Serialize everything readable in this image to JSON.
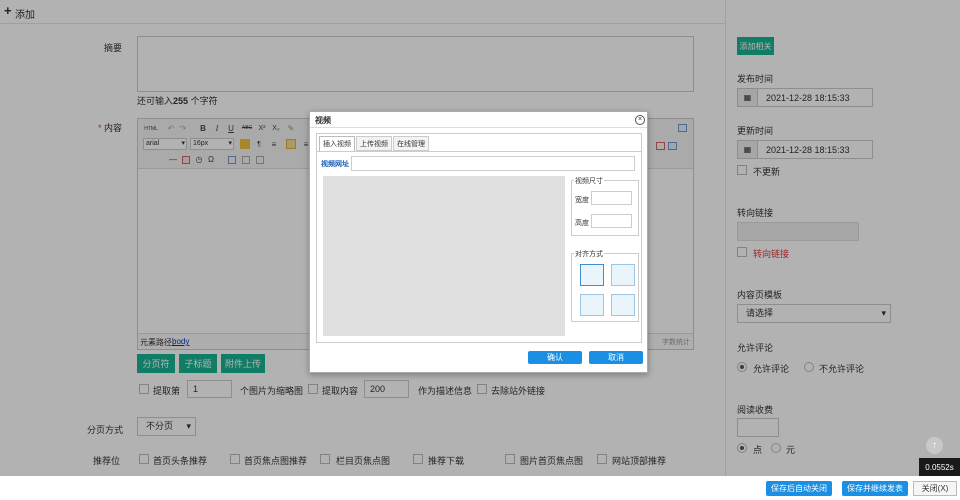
{
  "topbar": {
    "title": "添加",
    "close": "×"
  },
  "form": {
    "summary_label": "摘要",
    "summary_hint_prefix": "还可输入",
    "summary_hint_count": "255",
    "summary_hint_suffix": "个字符",
    "content_label": "内容",
    "required_mark": "*",
    "toolbar": {
      "html_btn": "HTML",
      "bold": "B",
      "italic": "I",
      "underline": "U",
      "strike": "ABC",
      "superscript": "X²",
      "subscript": "X₂",
      "font_family": "arial",
      "font_size": "16px",
      "omega": "Ω"
    },
    "element_path_label": "元素路径:",
    "element_path_value": "body",
    "word_count": "字数统计",
    "buttons": {
      "paging": "分页符",
      "subtitle": "子标题",
      "attachment": "附件上传"
    },
    "options": {
      "extract_label": "提取第",
      "extract_value": "1",
      "thumb_label": "个图片为缩略图",
      "extract_content_label": "提取内容",
      "extract_content_value": "200",
      "desc_label": "作为描述信息",
      "remove_links_label": "去除站外链接"
    },
    "paging_label": "分页方式",
    "paging_value": "不分页",
    "recommend_label": "推荐位",
    "recommend_items": [
      "首页头条推荐",
      "首页焦点图推荐",
      "栏目页焦点图",
      "推荐下载",
      "图片首页焦点图",
      "网站顶部推荐"
    ]
  },
  "side": {
    "related_btn": "添加相关",
    "publish_label": "发布时间",
    "publish_value": "2021-12-28 18:15:33",
    "update_label": "更新时间",
    "update_value": "2021-12-28 18:15:33",
    "no_update_label": "不更新",
    "redirect_label": "转向链接",
    "redirect_check_label": "转向链接",
    "template_label": "内容页模板",
    "template_value": "请选择",
    "comment_label": "允许评论",
    "comment_yes": "允许评论",
    "comment_no": "不允许评论",
    "fee_label": "阅读收费",
    "fee_point": "点",
    "fee_yuan": "元"
  },
  "dialog": {
    "title": "视频",
    "tabs": [
      "插入视频",
      "上传视频",
      "在线管理"
    ],
    "url_label": "视频网址",
    "size_legend": "视频尺寸",
    "width_label": "宽度",
    "height_label": "高度",
    "align_legend": "对齐方式",
    "ok": "确认",
    "cancel": "取消"
  },
  "footer": {
    "save_close": "保存后自动关闭",
    "save_continue": "保存并继续发表",
    "close": "关闭(X)",
    "timer": "0.0552s"
  },
  "colors": {
    "teal": "#1ab394",
    "blue": "#1a8fe3",
    "red": "#e0393e"
  }
}
